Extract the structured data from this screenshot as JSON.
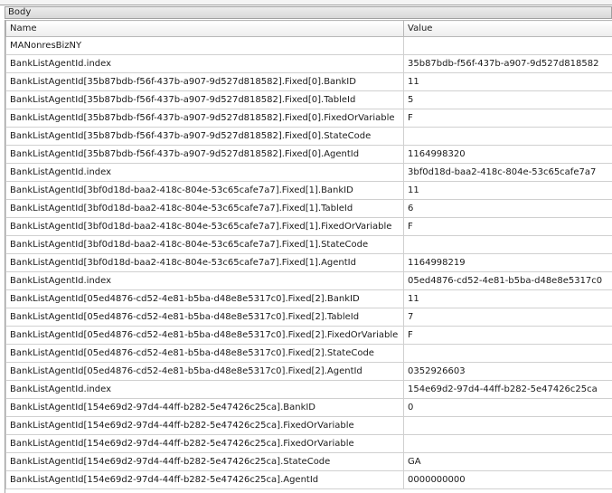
{
  "panel": {
    "title": "Body"
  },
  "columns": {
    "name": "Name",
    "value": "Value"
  },
  "rows": [
    {
      "name": "MANonresBizNY",
      "value": ""
    },
    {
      "name": "BankListAgentId.index",
      "value": "35b87bdb-f56f-437b-a907-9d527d818582"
    },
    {
      "name": "BankListAgentId[35b87bdb-f56f-437b-a907-9d527d818582].Fixed[0].BankID",
      "value": "11"
    },
    {
      "name": "BankListAgentId[35b87bdb-f56f-437b-a907-9d527d818582].Fixed[0].TableId",
      "value": "5"
    },
    {
      "name": "BankListAgentId[35b87bdb-f56f-437b-a907-9d527d818582].Fixed[0].FixedOrVariable",
      "value": "F"
    },
    {
      "name": "BankListAgentId[35b87bdb-f56f-437b-a907-9d527d818582].Fixed[0].StateCode",
      "value": ""
    },
    {
      "name": "BankListAgentId[35b87bdb-f56f-437b-a907-9d527d818582].Fixed[0].AgentId",
      "value": "1164998320"
    },
    {
      "name": "BankListAgentId.index",
      "value": "3bf0d18d-baa2-418c-804e-53c65cafe7a7"
    },
    {
      "name": "BankListAgentId[3bf0d18d-baa2-418c-804e-53c65cafe7a7].Fixed[1].BankID",
      "value": "11"
    },
    {
      "name": "BankListAgentId[3bf0d18d-baa2-418c-804e-53c65cafe7a7].Fixed[1].TableId",
      "value": "6"
    },
    {
      "name": "BankListAgentId[3bf0d18d-baa2-418c-804e-53c65cafe7a7].Fixed[1].FixedOrVariable",
      "value": "F"
    },
    {
      "name": "BankListAgentId[3bf0d18d-baa2-418c-804e-53c65cafe7a7].Fixed[1].StateCode",
      "value": ""
    },
    {
      "name": "BankListAgentId[3bf0d18d-baa2-418c-804e-53c65cafe7a7].Fixed[1].AgentId",
      "value": "1164998219"
    },
    {
      "name": "BankListAgentId.index",
      "value": "05ed4876-cd52-4e81-b5ba-d48e8e5317c0"
    },
    {
      "name": "BankListAgentId[05ed4876-cd52-4e81-b5ba-d48e8e5317c0].Fixed[2].BankID",
      "value": "11"
    },
    {
      "name": "BankListAgentId[05ed4876-cd52-4e81-b5ba-d48e8e5317c0].Fixed[2].TableId",
      "value": "7"
    },
    {
      "name": "BankListAgentId[05ed4876-cd52-4e81-b5ba-d48e8e5317c0].Fixed[2].FixedOrVariable",
      "value": "F"
    },
    {
      "name": "BankListAgentId[05ed4876-cd52-4e81-b5ba-d48e8e5317c0].Fixed[2].StateCode",
      "value": ""
    },
    {
      "name": "BankListAgentId[05ed4876-cd52-4e81-b5ba-d48e8e5317c0].Fixed[2].AgentId",
      "value": "0352926603"
    },
    {
      "name": "BankListAgentId.index",
      "value": "154e69d2-97d4-44ff-b282-5e47426c25ca"
    },
    {
      "name": "BankListAgentId[154e69d2-97d4-44ff-b282-5e47426c25ca].BankID",
      "value": "0"
    },
    {
      "name": "BankListAgentId[154e69d2-97d4-44ff-b282-5e47426c25ca].FixedOrVariable",
      "value": ""
    },
    {
      "name": "BankListAgentId[154e69d2-97d4-44ff-b282-5e47426c25ca].FixedOrVariable",
      "value": ""
    },
    {
      "name": "BankListAgentId[154e69d2-97d4-44ff-b282-5e47426c25ca].StateCode",
      "value": "GA"
    },
    {
      "name": "BankListAgentId[154e69d2-97d4-44ff-b282-5e47426c25ca].AgentId",
      "value": "0000000000"
    }
  ]
}
